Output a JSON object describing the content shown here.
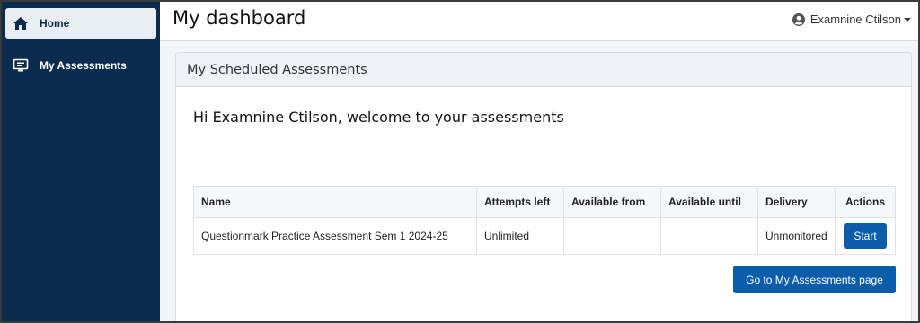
{
  "sidebar": {
    "items": [
      {
        "label": "Home",
        "icon": "home-icon",
        "active": true
      },
      {
        "label": "My Assessments",
        "icon": "monitor-icon",
        "active": false
      }
    ]
  },
  "header": {
    "title": "My dashboard",
    "user_name": "Examnine Ctilson"
  },
  "card": {
    "title": "My Scheduled Assessments",
    "welcome": "Hi Examnine Ctilson, welcome to your assessments",
    "table": {
      "columns": [
        "Name",
        "Attempts left",
        "Available from",
        "Available until",
        "Delivery",
        "Actions"
      ],
      "rows": [
        {
          "name": "Questionmark Practice Assessment Sem 1 2024-25",
          "attempts_left": "Unlimited",
          "available_from": "",
          "available_until": "",
          "delivery": "Unmonitored",
          "action": "Start"
        }
      ]
    },
    "go_button": "Go to My Assessments page"
  },
  "colors": {
    "sidebar_bg": "#0b2c4f",
    "primary_button": "#0b5cab",
    "active_nav_bg": "#e9eef5"
  }
}
